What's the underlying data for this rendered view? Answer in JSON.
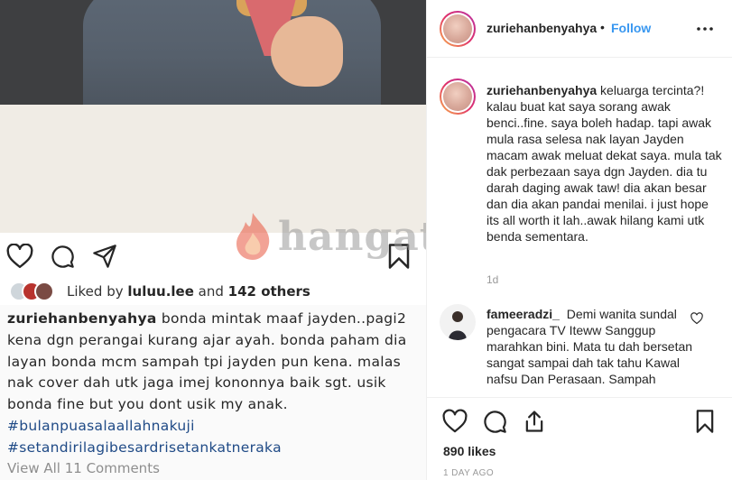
{
  "post": {
    "likes_row": {
      "prefix": "Liked by ",
      "user": "luluu.lee",
      "middle": " and ",
      "others": "142 others"
    },
    "caption": {
      "username": "zuriehanbenyahya",
      "text": "bonda mintak maaf jayden..pagi2 kena dgn perangai kurang ajar ayah. bonda paham dia layan bonda mcm sampah tpi jayden pun kena. malas nak cover dah utk jaga imej kononnya baik sgt. usik bonda fine but you dont usik my anak.",
      "hashtags": [
        "#bulanpuasalaallahnakuji",
        "#setandirilagibesardrisetankatneraka"
      ]
    },
    "view_comments": "View All 11 Comments"
  },
  "watermark": {
    "text": "hangat.com"
  },
  "panel": {
    "header": {
      "username": "zuriehanbenyahya",
      "separator": "•",
      "follow_label": "Follow"
    },
    "comments": [
      {
        "username": "zuriehanbenyahya",
        "text": "keluarga tercinta?! kalau buat kat saya sorang awak benci..fine. saya boleh hadap. tapi awak mula rasa selesa nak layan Jayden macam awak meluat dekat saya. mula tak dak perbezaan saya dgn Jayden. dia tu darah daging awak taw! dia akan besar dan dia akan pandai menilai. i just hope its all worth it lah..awak hilang kami utk benda sementara.",
        "time": "1d"
      },
      {
        "username": "fameeradzi_",
        "text": "Demi wanita sundal pengacara TV Iteww Sanggup marahkan bini. Mata tu dah bersetan sangat sampai dah tak tahu Kawal nafsu Dan Perasaan. Sampah"
      }
    ],
    "footer": {
      "likes": "890 likes",
      "date": "1 DAY AGO"
    }
  },
  "icons": {
    "heart": "heart-icon",
    "comment": "comment-icon",
    "share": "share-icon",
    "bookmark": "bookmark-icon",
    "more": "more-options-icon"
  },
  "colors": {
    "follow_blue": "#3897f0",
    "hashtag_blue": "#1f4a86",
    "muted_gray": "#999999"
  }
}
